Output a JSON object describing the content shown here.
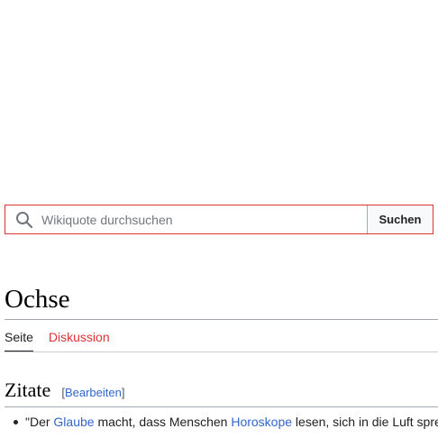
{
  "search": {
    "placeholder": "Wikiquote durchsuchen",
    "button_label": "Suchen",
    "icon": "search-icon"
  },
  "page": {
    "title": "Ochse"
  },
  "tabs": [
    {
      "label": "Seite",
      "active": true
    },
    {
      "label": "Diskussion",
      "active": false,
      "color": "#d33"
    }
  ],
  "section": {
    "title": "Zitate",
    "edit_open": "[",
    "edit_label": "Bearbeiten",
    "edit_close": "]"
  },
  "quotes": [
    {
      "text_1": "\"Der ",
      "link_1": "Glaube",
      "text_2": " macht, dass Menschen ",
      "link_2": "Horoskope",
      "text_3": " lesen, sich in die Luft spre"
    }
  ],
  "colors": {
    "link": "#3366cc",
    "red_link": "#d33",
    "search_border": "#d33"
  }
}
